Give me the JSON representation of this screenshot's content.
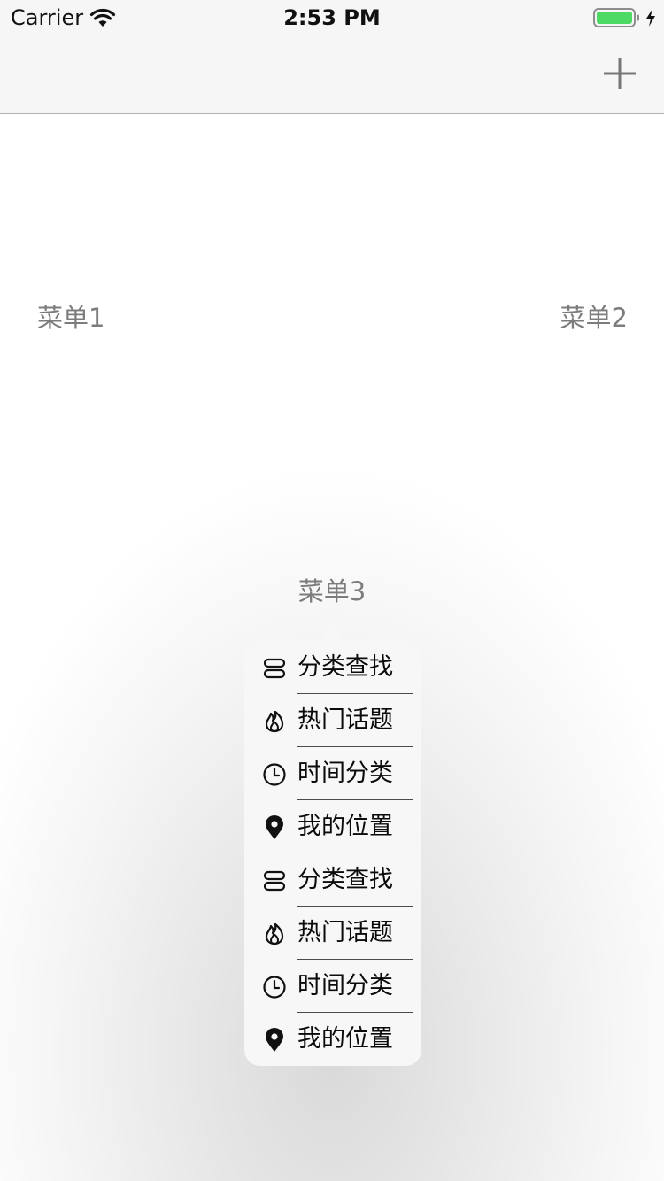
{
  "status_bar": {
    "carrier": "Carrier",
    "time": "2:53 PM",
    "wifi_icon": "wifi-icon",
    "battery_icon": "battery-icon",
    "battery_color": "#4cd964",
    "charging_icon": "bolt-icon"
  },
  "nav_bar": {
    "add_icon": "plus-icon"
  },
  "menus": {
    "menu1": "菜单1",
    "menu2": "菜单2",
    "menu3": "菜单3"
  },
  "popover": {
    "items": [
      {
        "label": "分类查找",
        "icon": "category-icon"
      },
      {
        "label": "热门话题",
        "icon": "flame-icon"
      },
      {
        "label": "时间分类",
        "icon": "clock-icon"
      },
      {
        "label": "我的位置",
        "icon": "location-pin-icon"
      },
      {
        "label": "分类查找",
        "icon": "category-icon"
      },
      {
        "label": "热门话题",
        "icon": "flame-icon"
      },
      {
        "label": "时间分类",
        "icon": "clock-icon"
      },
      {
        "label": "我的位置",
        "icon": "location-pin-icon"
      }
    ]
  }
}
